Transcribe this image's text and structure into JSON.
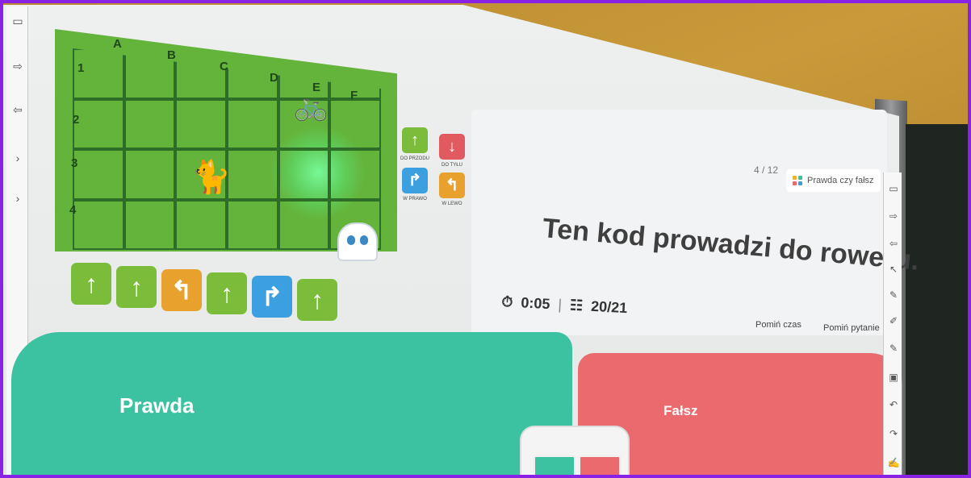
{
  "game": {
    "columns": [
      "A",
      "B",
      "C",
      "D",
      "E",
      "F"
    ],
    "rows": [
      "1",
      "2",
      "3",
      "4"
    ],
    "legend": [
      {
        "icon": "arrow-up-icon",
        "glyph": "↑",
        "color": "green",
        "label": "DO PRZODU"
      },
      {
        "icon": "arrow-down-icon",
        "glyph": "↓",
        "color": "red",
        "label": "DO TYŁU"
      },
      {
        "icon": "turn-right-icon",
        "glyph": "↱",
        "color": "blue",
        "label": "W PRAWO"
      },
      {
        "icon": "turn-left-icon",
        "glyph": "↰",
        "color": "orange",
        "label": "W LEWO"
      }
    ],
    "program": [
      {
        "icon": "arrow-up-icon",
        "glyph": "↑",
        "color": "green"
      },
      {
        "icon": "arrow-up-icon",
        "glyph": "↑",
        "color": "green"
      },
      {
        "icon": "turn-left-icon",
        "glyph": "↰",
        "color": "orange"
      },
      {
        "icon": "arrow-up-icon",
        "glyph": "↑",
        "color": "green"
      },
      {
        "icon": "turn-right-icon",
        "glyph": "↱",
        "color": "blue"
      },
      {
        "icon": "arrow-up-icon",
        "glyph": "↑",
        "color": "green"
      }
    ]
  },
  "quiz": {
    "counter": "4 / 12",
    "type_label": "Prawda czy fałsz",
    "question": "Ten kod prowadzi do roweru.",
    "timer": "0:05",
    "answered": "20/21",
    "skip_time": "Pomiń czas",
    "skip_question": "Pomiń pytanie"
  },
  "answers": {
    "true_label": "Prawda",
    "false_label": "Fałsz"
  },
  "colors": {
    "true": "#3cc2a1",
    "false": "#ea6a6d",
    "map": "#64b33a",
    "frame": "#8a22e6"
  }
}
